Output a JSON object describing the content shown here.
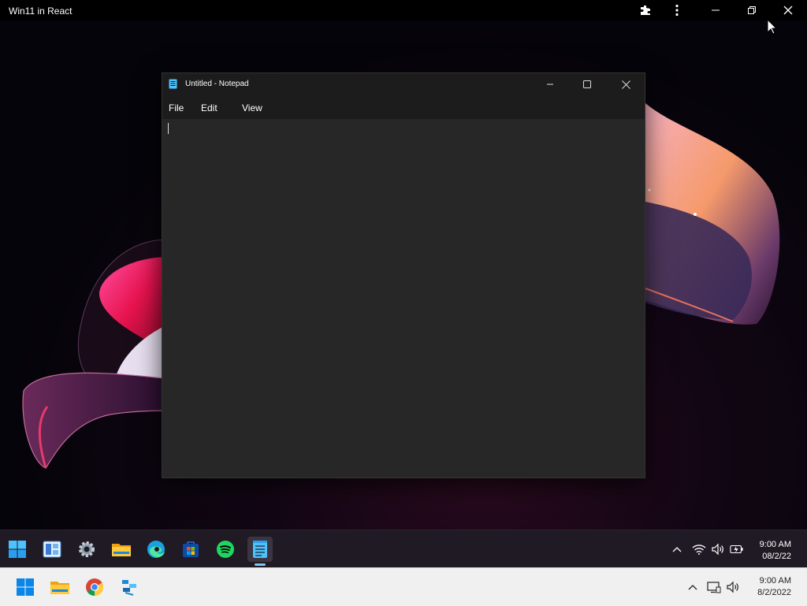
{
  "app_titlebar": {
    "title": "Win11 in React"
  },
  "notepad": {
    "title": "Untitled - Notepad",
    "menu": [
      "File",
      "Edit",
      "View"
    ],
    "content": ""
  },
  "w11_taskbar": {
    "apps": [
      "start-icon",
      "widgets-icon",
      "settings-icon",
      "file-explorer-icon",
      "edge-icon",
      "store-icon",
      "spotify-icon",
      "notepad-icon"
    ],
    "time": "9:00 AM",
    "date": "08/2/22"
  },
  "os_taskbar": {
    "apps": [
      "windows-start-icon",
      "file-explorer-icon",
      "chrome-icon",
      "app-icon"
    ],
    "time": "9:00 AM",
    "date": "8/2/2022"
  },
  "colors": {
    "accent_blue": "#4cc2ff",
    "notepad_bg": "#272727",
    "taskbar_dark": "#1f1a23"
  }
}
